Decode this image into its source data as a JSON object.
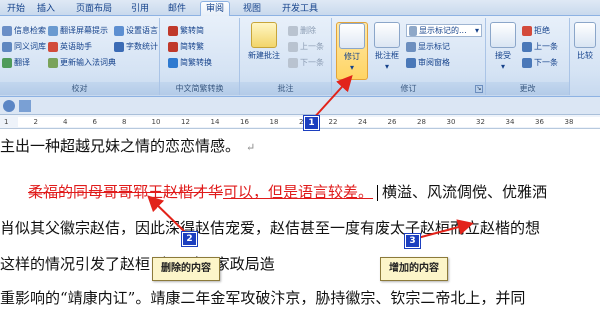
{
  "tabs": [
    {
      "label": "开始"
    },
    {
      "label": "插入"
    },
    {
      "label": "页面布局"
    },
    {
      "label": "引用"
    },
    {
      "label": "邮件"
    },
    {
      "label": "审阅"
    },
    {
      "label": "视图"
    },
    {
      "label": "开发工具"
    }
  ],
  "active_tab": "审阅",
  "ribbon": {
    "proofing": {
      "label": "校对",
      "buttons": [
        "信息检索",
        "同义词库",
        "翻译",
        "翻译屏幕提示",
        "英语助手",
        "更新输入法词典",
        "设置语言",
        "字数统计"
      ]
    },
    "chinese": {
      "label": "中文简繁转换",
      "buttons": [
        "繁转简",
        "简转繁",
        "简繁转换"
      ]
    },
    "comments": {
      "label": "批注",
      "new_label": "新建批注",
      "buttons": [
        "删除",
        "上一条",
        "下一条"
      ]
    },
    "tracking": {
      "label": "修订",
      "track_label": "修订",
      "balloon_label": "批注框",
      "display_select": "显示标记的...",
      "show_markup": "显示标记",
      "reviewing_pane": "审阅窗格"
    },
    "changes": {
      "label": "更改",
      "accept_label": "接受",
      "buttons": [
        "拒绝",
        "上一条",
        "下一条"
      ]
    },
    "compare": {
      "label": "比较"
    }
  },
  "ruler_ticks": [
    "1",
    "2",
    "4",
    "6",
    "8",
    "10",
    "12",
    "14",
    "16",
    "18",
    "20",
    "22",
    "24",
    "26",
    "28",
    "30",
    "32",
    "34",
    "36",
    "38"
  ],
  "document": {
    "line1": "主出一种超越兄妹之情的恋恋情感。",
    "para_mark": "↵",
    "deleted_text": "柔福的同母哥哥郓王赵楷才华",
    "inserted_text": "可以，但是语言较差。",
    "line2_rest": "横溢、风流倜傥、优雅洒",
    "line3": "肖似其父徽宗赵佶，因此深得赵佶宠爱，赵佶甚至一度有废太子赵桓而立赵楷的想",
    "line4": "这样的情况引发了赵桓                                                致了对国家政局造",
    "line5": "重影响的“靖康内讧”。靖康二年金军攻破汴京，胁持徽宗、钦宗二帝北上，并同"
  },
  "callouts": {
    "deleted": "删除的内容",
    "added": "增加的内容"
  },
  "markers": [
    "1",
    "2",
    "3"
  ]
}
